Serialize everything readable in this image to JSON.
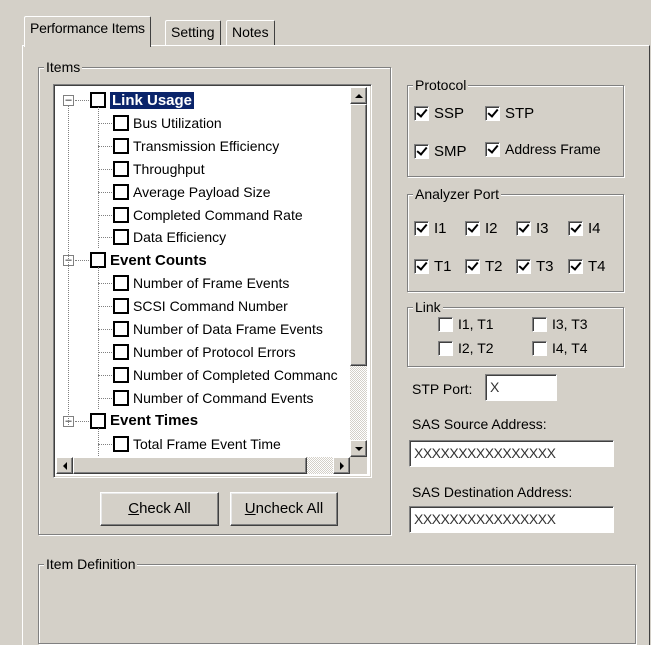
{
  "tabs": [
    {
      "label": "Performance Items",
      "active": true
    },
    {
      "label": "Setting",
      "active": false
    },
    {
      "label": "Notes",
      "active": false
    }
  ],
  "items_group": {
    "legend": "Items",
    "tree": [
      {
        "label": "Link Usage",
        "type": "parent",
        "expanded": true,
        "selected": true
      },
      {
        "label": "Bus Utilization",
        "type": "child"
      },
      {
        "label": "Transmission Efficiency",
        "type": "child"
      },
      {
        "label": "Throughput",
        "type": "child"
      },
      {
        "label": "Average Payload Size",
        "type": "child"
      },
      {
        "label": "Completed Command Rate",
        "type": "child"
      },
      {
        "label": "Data Efficiency",
        "type": "child"
      },
      {
        "label": "Event Counts",
        "type": "parent",
        "expanded": true
      },
      {
        "label": "Number of Frame Events",
        "type": "child"
      },
      {
        "label": "SCSI Command Number",
        "type": "child"
      },
      {
        "label": "Number of Data Frame Events",
        "type": "child"
      },
      {
        "label": "Number of Protocol Errors",
        "type": "child"
      },
      {
        "label": "Number of Completed Commanc",
        "type": "child"
      },
      {
        "label": "Number of Command Events",
        "type": "child"
      },
      {
        "label": "Event Times",
        "type": "parent",
        "expanded": true
      },
      {
        "label": "Total Frame Event Time",
        "type": "child"
      }
    ],
    "check_all_label": "Check All",
    "check_all_accel": "C",
    "check_all_rest": "heck All",
    "uncheck_all_label": "Uncheck All",
    "uncheck_all_accel": "U",
    "uncheck_all_rest": "ncheck All"
  },
  "protocol": {
    "legend": "Protocol",
    "options": [
      {
        "label": "SSP",
        "checked": true
      },
      {
        "label": "STP",
        "checked": true
      },
      {
        "label": "SMP",
        "checked": true
      },
      {
        "label": "Address Frame",
        "checked": true
      }
    ]
  },
  "analyzer_port": {
    "legend": "Analyzer Port",
    "ports": [
      {
        "label": "I1",
        "checked": true
      },
      {
        "label": "I2",
        "checked": true
      },
      {
        "label": "I3",
        "checked": true
      },
      {
        "label": "I4",
        "checked": true
      },
      {
        "label": "T1",
        "checked": true
      },
      {
        "label": "T2",
        "checked": true
      },
      {
        "label": "T3",
        "checked": true
      },
      {
        "label": "T4",
        "checked": true
      }
    ]
  },
  "link": {
    "legend": "Link",
    "options": [
      {
        "label": "I1, T1",
        "checked": false
      },
      {
        "label": "I3, T3",
        "checked": false
      },
      {
        "label": "I2, T2",
        "checked": false
      },
      {
        "label": "I4, T4",
        "checked": false
      }
    ]
  },
  "stp_port": {
    "label": "STP Port:",
    "value": "X"
  },
  "sas_source": {
    "label": "SAS Source Address:",
    "value": "XXXXXXXXXXXXXXXX"
  },
  "sas_destination": {
    "label": "SAS Destination Address:",
    "value": "XXXXXXXXXXXXXXXX"
  },
  "item_definition": {
    "legend": "Item Definition"
  }
}
